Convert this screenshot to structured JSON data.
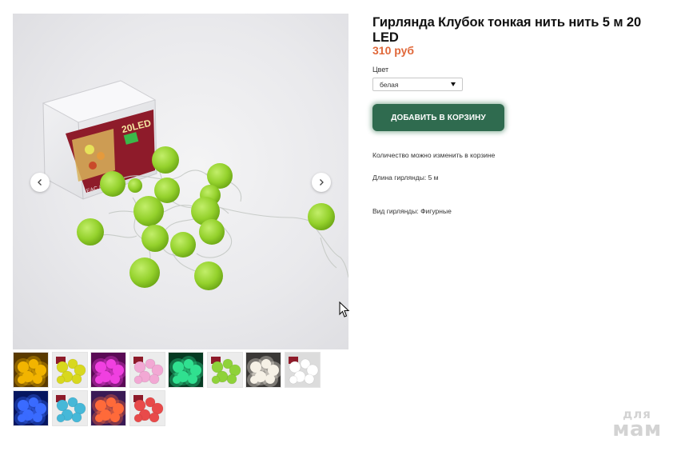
{
  "product": {
    "title": "Гирлянда Клубок тонкая нить нить 5 м 20 LED",
    "price": "310 руб",
    "color_label": "Цвет",
    "color_selected": "белая",
    "add_to_cart_label": "ДОБАВИТЬ В КОРЗИНУ",
    "qty_note": "Количество можно изменить в корзине",
    "length_note": "Длина гирлянды: 5 м",
    "kind_note": "Вид гирлянды: Фигурные"
  },
  "gallery": {
    "box_label": "20LED",
    "prev_icon": "chevron-left-icon",
    "next_icon": "chevron-right-icon",
    "thumbnails": [
      {
        "name": "thumb-yellow-lit",
        "color": "#f2b400",
        "bg": "#5a3a00",
        "lit": true
      },
      {
        "name": "thumb-yellow",
        "color": "#d8d81e",
        "bg": "#ececec",
        "lit": false
      },
      {
        "name": "thumb-pink-lit",
        "color": "#f040e0",
        "bg": "#5a0a55",
        "lit": true
      },
      {
        "name": "thumb-pink",
        "color": "#f2a8d4",
        "bg": "#ececec",
        "lit": false
      },
      {
        "name": "thumb-green-lit",
        "color": "#30e090",
        "bg": "#063a22",
        "lit": true
      },
      {
        "name": "thumb-green",
        "color": "#8fd23a",
        "bg": "#ececec",
        "lit": false
      },
      {
        "name": "thumb-white-lit",
        "color": "#f6f1e6",
        "bg": "#3a3836",
        "lit": true
      },
      {
        "name": "thumb-white",
        "color": "#ffffff",
        "bg": "#dcdcdc",
        "lit": false
      },
      {
        "name": "thumb-blue-lit",
        "color": "#3a6bff",
        "bg": "#061660",
        "lit": true
      },
      {
        "name": "thumb-blue",
        "color": "#46b8d8",
        "bg": "#ececec",
        "lit": false
      },
      {
        "name": "thumb-multicolor-lit",
        "color": "#ff6a3a",
        "bg": "#3a1a55",
        "lit": true
      },
      {
        "name": "thumb-multicolor",
        "color": "#e84a4a",
        "bg": "#ececec",
        "lit": false
      }
    ]
  },
  "watermark": {
    "top": "для",
    "bottom": "мам"
  },
  "colors": {
    "accent_price": "#e0683a",
    "button": "#2f6b4f",
    "ball_green": "#9cd53a"
  }
}
